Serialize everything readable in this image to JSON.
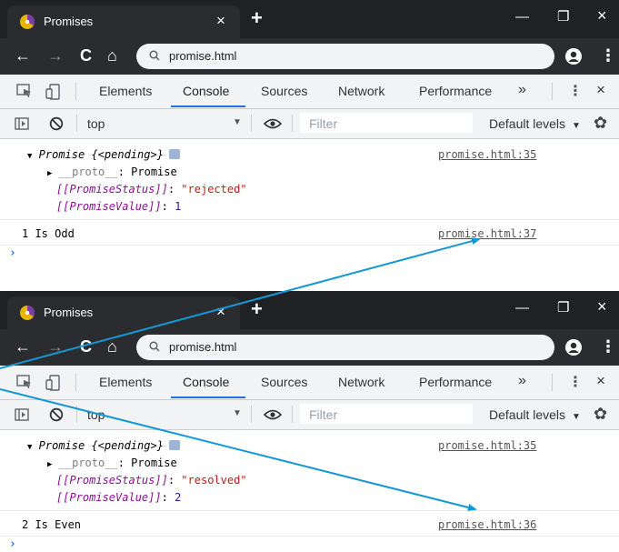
{
  "windows": [
    {
      "tab_title": "Promises",
      "url": "promise.html",
      "devtools_tabs": [
        "Elements",
        "Console",
        "Sources",
        "Network",
        "Performance"
      ],
      "active_tab": "Console",
      "context": "top",
      "filter_placeholder": "Filter",
      "levels": "Default levels",
      "promise_label": "Promise {<pending>}",
      "proto_key": "__proto__",
      "proto_value": "Promise",
      "status_key": "[[PromiseStatus]]",
      "status_value": "\"rejected\"",
      "value_key": "[[PromiseValue]]",
      "value_value": "1",
      "log_message": "1 Is Odd",
      "promise_source": "promise.html:35",
      "log_source": "promise.html:37"
    },
    {
      "tab_title": "Promises",
      "url": "promise.html",
      "devtools_tabs": [
        "Elements",
        "Console",
        "Sources",
        "Network",
        "Performance"
      ],
      "active_tab": "Console",
      "context": "top",
      "filter_placeholder": "Filter",
      "levels": "Default levels",
      "promise_label": "Promise {<pending>}",
      "proto_key": "__proto__",
      "proto_value": "Promise",
      "status_key": "[[PromiseStatus]]",
      "status_value": "\"resolved\"",
      "value_key": "[[PromiseValue]]",
      "value_value": "2",
      "log_message": "2 Is Even",
      "promise_source": "promise.html:35",
      "log_source": "promise.html:36"
    }
  ],
  "symbols": {
    "close": "×",
    "new_tab": "+",
    "minimize": "—",
    "maximize": "❐",
    "back": "←",
    "forward": "→",
    "reload": "C",
    "home": "⌂",
    "menu": "⋮",
    "more_tabs": "»",
    "dropdown": "▼",
    "expanded": "▼",
    "collapsed": "▶",
    "colon": ":",
    "prompt": "›",
    "gear": "✿"
  },
  "colors": {
    "title_bar": "#202124",
    "active_tab_underline": "#1a73e8",
    "arrow": "#1497d4",
    "status_string": "#c41a16",
    "property_key": "#881391"
  }
}
